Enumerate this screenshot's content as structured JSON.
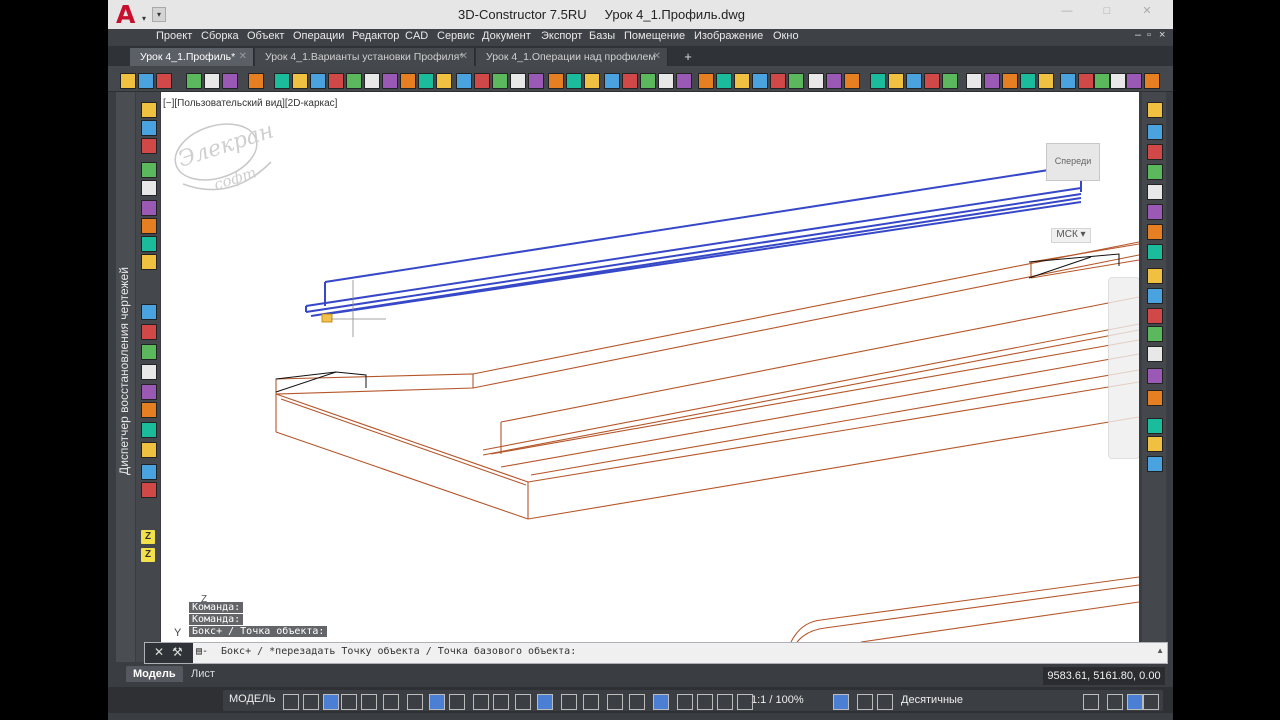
{
  "window": {
    "app_name": "3D-Constructor 7.5RU",
    "file_name": "Урок 4_1.Профиль.dwg",
    "controls": [
      "—",
      "□",
      "✕"
    ]
  },
  "menu": [
    "Проект",
    "Сборка",
    "Объект",
    "Операции",
    "Редактор",
    "CAD",
    "Сервис",
    "Документ",
    "Экспорт",
    "Базы",
    "Помещение",
    "Изображение",
    "Окно"
  ],
  "doc_tabs": [
    {
      "label": "Урок 4_1.Профиль*",
      "active": true
    },
    {
      "label": "Урок 4_1.Варианты установки Профиля*",
      "active": false
    },
    {
      "label": "Урок 4_1.Операции над профилем",
      "active": false
    }
  ],
  "tab_close_glyph": "✕",
  "tab_add_glyph": "+",
  "viewport": {
    "label": "[−][Пользовательский вид][2D-каркас]",
    "viewcube_face": "Спереди",
    "wcs_label": "МСК ▾",
    "watermark_logo": "Элекран софт"
  },
  "side_panel_label": "Диспетчер восстановления чертежей",
  "ucs_icon": {
    "z": "Z",
    "y": "Y"
  },
  "command_history": [
    "Команда:",
    "Команда:",
    "Бокс+ / Точка объекта:"
  ],
  "command_line": {
    "text": "Бокс+ / *перезадать Точку объекта / Точка базового объекта:",
    "close_glyph": "✕",
    "tools_glyph": "⚒",
    "prompt_glyph": "▤-",
    "scroll_glyph": "▲"
  },
  "layout_tabs": [
    {
      "label": "Модель",
      "active": true
    },
    {
      "label": "Лист",
      "active": false
    }
  ],
  "coordinates": "9583.61, 5161.80, 0.00",
  "status_bar": {
    "model": "МОДЕЛЬ",
    "scale": "1:1 / 100%",
    "units": "Десятичные"
  },
  "left_toolbar_z_labels": [
    "Z",
    "Z"
  ],
  "colors": {
    "profile": "#3648c8",
    "box": "#b5562a",
    "canvas": "#ffffff",
    "chrome": "#3a3d42",
    "title": "#e6e6e6"
  }
}
